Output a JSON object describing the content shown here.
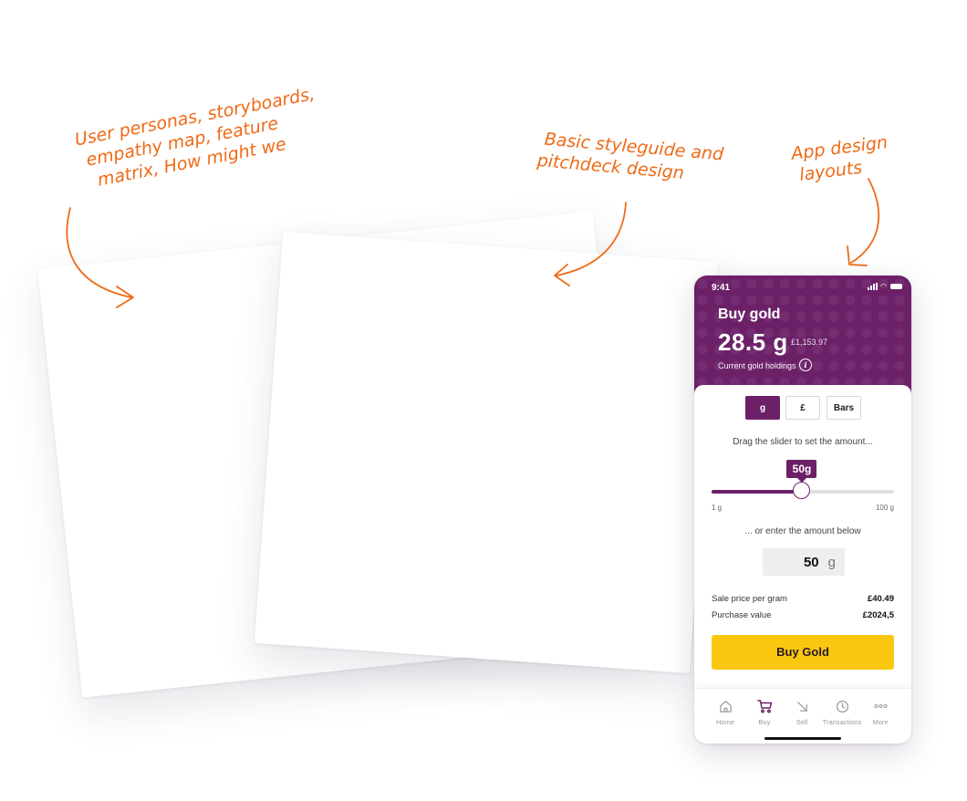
{
  "annotations": {
    "research": [
      "User personas, storyboards,",
      "empathy map, feature",
      "matrix, How might we"
    ],
    "styleguide": [
      "Basic styleguide and",
      "pitchdeck design"
    ],
    "app": [
      "App design",
      "layouts"
    ]
  },
  "phone": {
    "status_time": "9:41",
    "header": {
      "title": "Buy gold",
      "holdings_amount": "28.5 g",
      "holdings_value": "£1,153.97",
      "holdings_label": "Current gold holdings"
    },
    "unit_tabs": [
      "g",
      "£",
      "Bars"
    ],
    "selected_unit": "g",
    "slider": {
      "prompt": "Drag the slider to set the amount...",
      "bubble": "50g",
      "value": 50,
      "min": 1,
      "max": 100,
      "min_label": "1 g",
      "max_label": "100 g"
    },
    "enter_prompt": "... or enter the amount below",
    "amount_input": {
      "value": "50",
      "unit": "g"
    },
    "sale_price": {
      "label": "Sale price per gram",
      "value": "£40.49"
    },
    "purchase_value": {
      "label": "Purchase value",
      "value": "£2024,5"
    },
    "buy_button": "Buy Gold",
    "nav": [
      {
        "label": "Home",
        "icon": "home-icon"
      },
      {
        "label": "Buy",
        "icon": "cart-icon"
      },
      {
        "label": "Sell",
        "icon": "arrow-down-right-icon"
      },
      {
        "label": "Transactions",
        "icon": "clock-icon"
      },
      {
        "label": "More",
        "icon": "more-icon"
      }
    ],
    "active_nav": "Buy",
    "colors": {
      "brand": "#6b2068",
      "accent": "#f9c70f",
      "annotation": "#ef6a16"
    }
  }
}
